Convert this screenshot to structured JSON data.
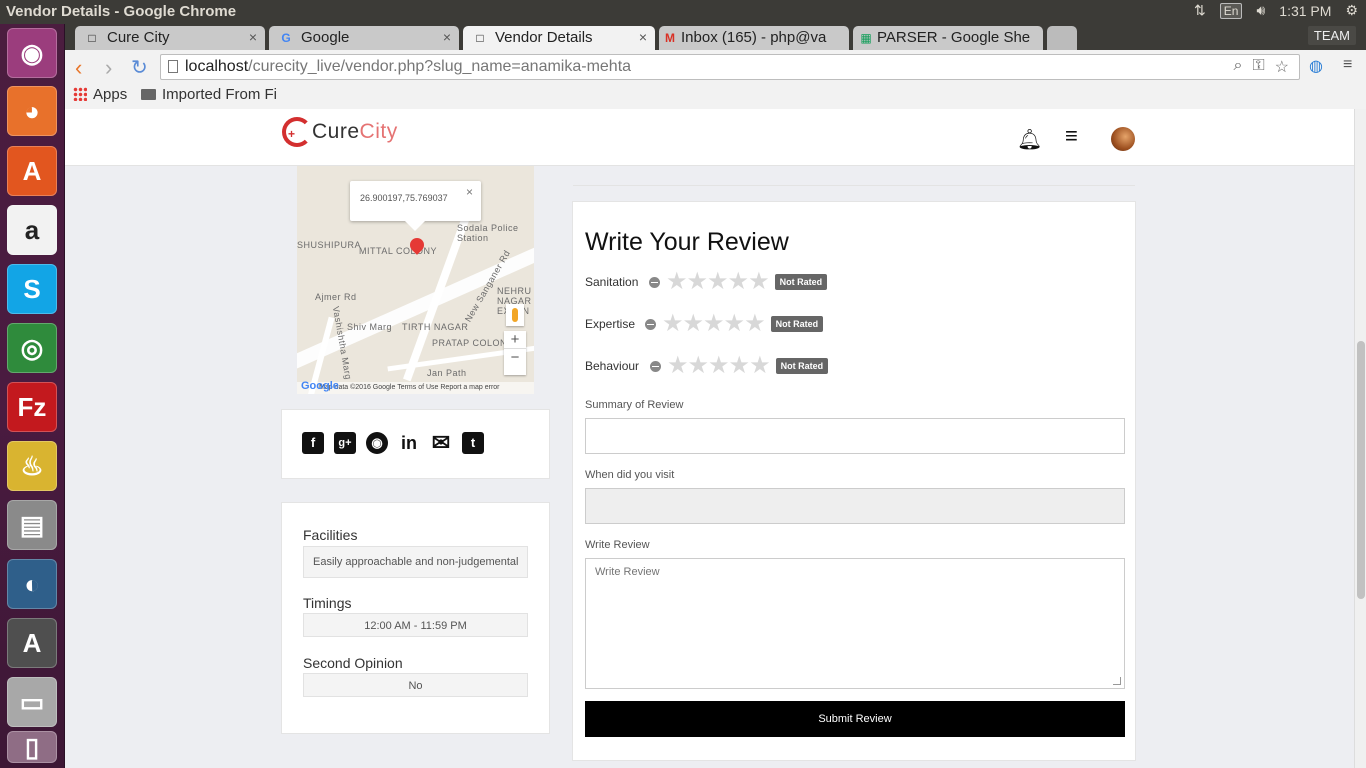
{
  "os": {
    "window_title": "Vendor Details - Google Chrome",
    "lang": "En",
    "time": "1:31 PM",
    "launcher": [
      {
        "name": "ubuntu-dash-icon",
        "glyph": "◉",
        "color": "#9b3d7d"
      },
      {
        "name": "firefox-icon",
        "glyph": "◕",
        "color": "#e8712b"
      },
      {
        "name": "software-center-icon",
        "glyph": "A",
        "color": "#e2561f"
      },
      {
        "name": "amazon-icon",
        "glyph": "a",
        "color": "#f2f2f2"
      },
      {
        "name": "skype-icon",
        "glyph": "S",
        "color": "#12a5e6"
      },
      {
        "name": "chrome-icon",
        "glyph": "◎",
        "color": "#2f8b3c"
      },
      {
        "name": "filezilla-icon",
        "glyph": "Fz",
        "color": "#c3191e"
      },
      {
        "name": "teapot-icon",
        "glyph": "♨",
        "color": "#d9b430"
      },
      {
        "name": "file-manager-icon",
        "glyph": "▤",
        "color": "#8a8a8a"
      },
      {
        "name": "mysql-workbench-icon",
        "glyph": "◐",
        "color": "#2f5f8a"
      },
      {
        "name": "software-updater-icon",
        "glyph": "A",
        "color": "#4f4f4f"
      },
      {
        "name": "drive-icon",
        "glyph": "▭",
        "color": "#a8a8a8"
      },
      {
        "name": "trash-icon",
        "glyph": "▯",
        "color": "#8f6d85"
      }
    ]
  },
  "browser": {
    "tabs": [
      {
        "title": "Cure City",
        "icon": "□"
      },
      {
        "title": "Google",
        "icon": "G"
      },
      {
        "title": "Vendor Details",
        "icon": "□"
      },
      {
        "title": "Inbox (165) - php@va",
        "icon": "M"
      },
      {
        "title": "PARSER - Google She",
        "icon": "▦"
      }
    ],
    "team_label": "TEAM",
    "url_host": "localhost",
    "url_path": "/curecity_live/vendor.php?slug_name=anamika-mehta",
    "bookmarks": {
      "apps": "Apps",
      "folder": "Imported From Fi"
    }
  },
  "site": {
    "logo_cure": "Cure",
    "logo_city": "City",
    "map": {
      "popup_coords": "26.900197,75.769037",
      "labels": [
        "Sodala Police Station",
        "MITTAL COLONY",
        "SHUSHIPURA",
        "Ajmer Rd",
        "New Sanganer Rd",
        "NEHRU NAGAR EXTEN",
        "Shiv Marg",
        "TIRTH NAGAR",
        "PRATAP COLONY",
        "Jan Path",
        "Vashishtha Marg",
        "Ajmer Rd"
      ],
      "footer": "Map data ©2016 Google   Terms of Use   Report a map error",
      "google": "Google"
    },
    "info": {
      "facilities_label": "Facilities",
      "facilities_value": "Easily approachable and non-judgemental",
      "timings_label": "Timings",
      "timings_value": "12:00 AM - 11:59 PM",
      "second_opinion_label": "Second Opinion",
      "second_opinion_value": "No"
    },
    "review": {
      "heading": "Write Your Review",
      "ratings": [
        {
          "label": "Sanitation",
          "badge": "Not Rated",
          "stars": 0
        },
        {
          "label": "Expertise",
          "badge": "Not Rated",
          "stars": 0
        },
        {
          "label": "Behaviour",
          "badge": "Not Rated",
          "stars": 0
        }
      ],
      "summary_label": "Summary of Review",
      "summary_value": "",
      "visit_label": "When did you visit",
      "visit_value": "",
      "write_label": "Write Review",
      "write_placeholder": "Write Review",
      "submit_label": "Submit Review"
    }
  }
}
